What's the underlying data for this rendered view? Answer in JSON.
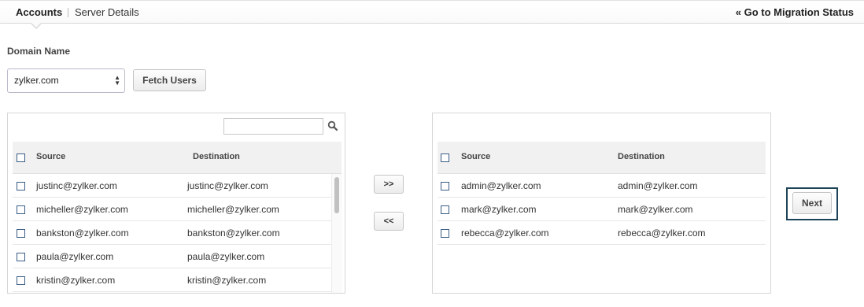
{
  "tabs": {
    "accounts": "Accounts",
    "server_details": "Server Details"
  },
  "goto_link": "« Go to Migration Status",
  "domain": {
    "label": "Domain Name",
    "selected": "zylker.com"
  },
  "fetch_label": "Fetch Users",
  "columns": {
    "source": "Source",
    "destination": "Destination"
  },
  "available_users": [
    {
      "source": "justinc@zylker.com",
      "destination": "justinc@zylker.com"
    },
    {
      "source": "micheller@zylker.com",
      "destination": "micheller@zylker.com"
    },
    {
      "source": "bankston@zylker.com",
      "destination": "bankston@zylker.com"
    },
    {
      "source": "paula@zylker.com",
      "destination": "paula@zylker.com"
    },
    {
      "source": "kristin@zylker.com",
      "destination": "kristin@zylker.com"
    }
  ],
  "selected_users": [
    {
      "source": "admin@zylker.com",
      "destination": "admin@zylker.com"
    },
    {
      "source": "mark@zylker.com",
      "destination": "mark@zylker.com"
    },
    {
      "source": "rebecca@zylker.com",
      "destination": "rebecca@zylker.com"
    }
  ],
  "move_right_label": ">>",
  "move_left_label": "<<",
  "next_label": "Next",
  "icons": {
    "search": "search-icon",
    "select_arrows": "select-arrows-icon",
    "checkbox": "checkbox-icon"
  },
  "colors": {
    "checkbox_border": "#3a5d86",
    "next_highlight": "#1d4358"
  }
}
